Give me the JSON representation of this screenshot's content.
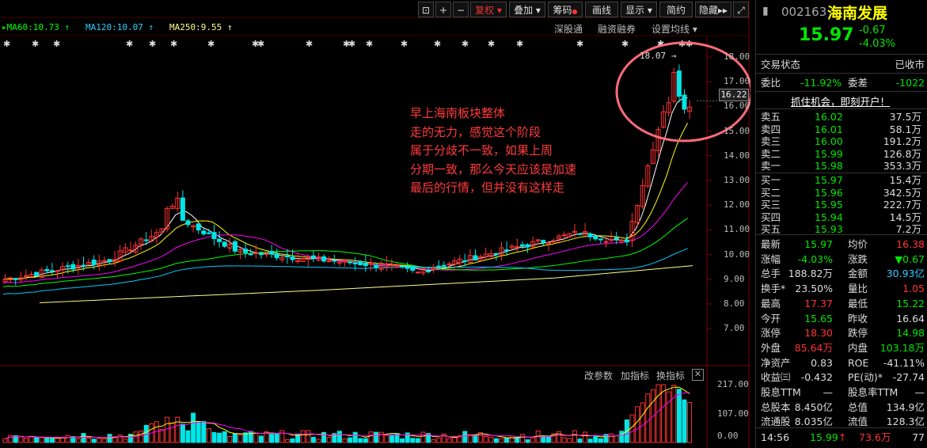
{
  "toolbar": {
    "buttons": [
      "+",
      "−",
      "复权",
      "叠加",
      "筹码",
      "画线",
      "显示",
      "简约",
      "隐藏"
    ],
    "fuquan": "复权",
    "diejia": "叠加",
    "chouma": "筹码",
    "huaxian": "画线",
    "xianshi": "显示",
    "jianyue": "简约",
    "yincang": "隐藏"
  },
  "ma_legend": {
    "ma60": "MA60:10.73",
    "ma120": "MA120:10.07",
    "ma250": "MA250:9.55"
  },
  "chart_links": {
    "shengutong": "深股通",
    "rongzi": "融资融券",
    "shezhi": "设置均线"
  },
  "price_axis": [
    "18.00",
    "17.00",
    "16.00",
    "15.00",
    "14.00",
    "13.00",
    "12.00",
    "11.00",
    "10.00",
    "9.00",
    "8.00",
    "7.00"
  ],
  "current_price_tag": "16.22",
  "high_marker": "18.07",
  "annotation": "早上海南板块整体\n走的无力，感觉这个阶段\n属于分歧不一致，如果上周\n分期一致，那么今天应该是加速\n最后的行情，但并没有这样走",
  "sub_panel": {
    "gaicanshu": "改参数",
    "jiazhibiao": "加指标",
    "huanzhibiao": "换指标",
    "axis": [
      "217.00",
      "107.00",
      "0.00"
    ]
  },
  "stock": {
    "code": "002163",
    "name": "海南发展",
    "price": "15.97",
    "change": "-0.67",
    "change_pct": "-4.03%"
  },
  "status": {
    "label": "交易状态",
    "value": "已收市"
  },
  "weibi": {
    "label1": "委比",
    "value1": "-11.92%",
    "label2": "委差",
    "value2": "-1022"
  },
  "ad": "抓住机会，即刻开户！",
  "asks": [
    {
      "label": "卖五",
      "price": "16.02",
      "vol": "37.5万"
    },
    {
      "label": "卖四",
      "price": "16.01",
      "vol": "58.1万"
    },
    {
      "label": "卖三",
      "price": "16.00",
      "vol": "191.2万"
    },
    {
      "label": "卖二",
      "price": "15.99",
      "vol": "126.8万"
    },
    {
      "label": "卖一",
      "price": "15.98",
      "vol": "353.3万"
    }
  ],
  "bids": [
    {
      "label": "买一",
      "price": "15.97",
      "vol": "15.4万"
    },
    {
      "label": "买二",
      "price": "15.96",
      "vol": "342.5万"
    },
    {
      "label": "买三",
      "price": "15.95",
      "vol": "222.7万"
    },
    {
      "label": "买四",
      "price": "15.94",
      "vol": "14.5万"
    },
    {
      "label": "买五",
      "price": "15.93",
      "vol": "7.2万"
    }
  ],
  "stats": [
    {
      "l1": "最新",
      "v1": "15.97",
      "c1": "green",
      "l2": "均价",
      "v2": "16.38",
      "c2": "red"
    },
    {
      "l1": "涨幅",
      "v1": "-4.03%",
      "c1": "green",
      "l2": "涨跌",
      "v2": "▼0.67",
      "c2": "green"
    },
    {
      "l1": "总手",
      "v1": "188.82万",
      "c1": "white",
      "l2": "金额",
      "v2": "30.93亿",
      "c2": "cyan"
    },
    {
      "l1": "换手*",
      "v1": "23.50%",
      "c1": "white",
      "l2": "量比",
      "v2": "1.05",
      "c2": "red"
    },
    {
      "l1": "最高",
      "v1": "17.37",
      "c1": "red",
      "l2": "最低",
      "v2": "15.22",
      "c2": "green"
    },
    {
      "l1": "今开",
      "v1": "15.65",
      "c1": "green",
      "l2": "昨收",
      "v2": "16.64",
      "c2": "white"
    },
    {
      "l1": "涨停",
      "v1": "18.30",
      "c1": "red",
      "l2": "跌停",
      "v2": "14.98",
      "c2": "green"
    },
    {
      "l1": "外盘",
      "v1": "85.64万",
      "c1": "red",
      "l2": "内盘",
      "v2": "103.18万",
      "c2": "green"
    },
    {
      "l1": "净资产",
      "v1": "0.83",
      "c1": "white",
      "l2": "ROE",
      "v2": "-41.11%",
      "c2": "white"
    },
    {
      "l1": "收益㈢",
      "v1": "-0.432",
      "c1": "white",
      "l2": "PE(动)*",
      "v2": "-27.74",
      "c2": "white"
    },
    {
      "l1": "股息TTM",
      "v1": "—",
      "c1": "white",
      "l2": "股息率TTM",
      "v2": "—",
      "c2": "white"
    },
    {
      "l1": "总股本",
      "v1": "8.450亿",
      "c1": "white",
      "l2": "总值",
      "v2": "134.9亿",
      "c2": "white"
    },
    {
      "l1": "流通股",
      "v1": "8.035亿",
      "c1": "white",
      "l2": "流值",
      "v2": "128.3亿",
      "c2": "white"
    }
  ],
  "tick": {
    "time": "14:56",
    "price": "15.99",
    "arrow": "↑",
    "vol": "73.6万",
    "count": "77"
  },
  "colors": {
    "up": "#ff3232",
    "down": "#00e6e6",
    "ma5": "#ffffff",
    "ma10": "#ffff00",
    "ma20": "#ff00ff",
    "ma60": "#00ff00",
    "ma120": "#00ccff",
    "ma250": "#ffff88"
  }
}
